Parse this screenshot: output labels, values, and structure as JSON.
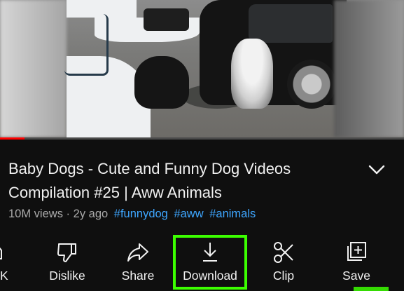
{
  "video": {
    "progress_fraction": 0.06,
    "colors": {
      "progress": "#ff0000",
      "track": "#4a4a4a"
    }
  },
  "details": {
    "title": "Baby Dogs - Cute and Funny Dog Videos Compilation #25 | Aww Animals",
    "views": "10M views",
    "separator": "·",
    "age": "2y ago",
    "hashtags": [
      "#funnydog",
      "#aww",
      "#animals"
    ]
  },
  "actions": {
    "partial_like_label": "K",
    "dislike": {
      "label": "Dislike",
      "icon": "thumbs-down-icon"
    },
    "share": {
      "label": "Share",
      "icon": "share-arrow-icon"
    },
    "download": {
      "label": "Download",
      "icon": "download-icon"
    },
    "clip": {
      "label": "Clip",
      "icon": "scissors-icon"
    },
    "save": {
      "label": "Save",
      "icon": "add-to-playlist-icon"
    }
  },
  "colors": {
    "background": "#0f0f0f",
    "text": "#f1f1f1",
    "meta": "#aaaaaa",
    "hashtag": "#3ea6ff",
    "highlight": "#3cff00"
  }
}
